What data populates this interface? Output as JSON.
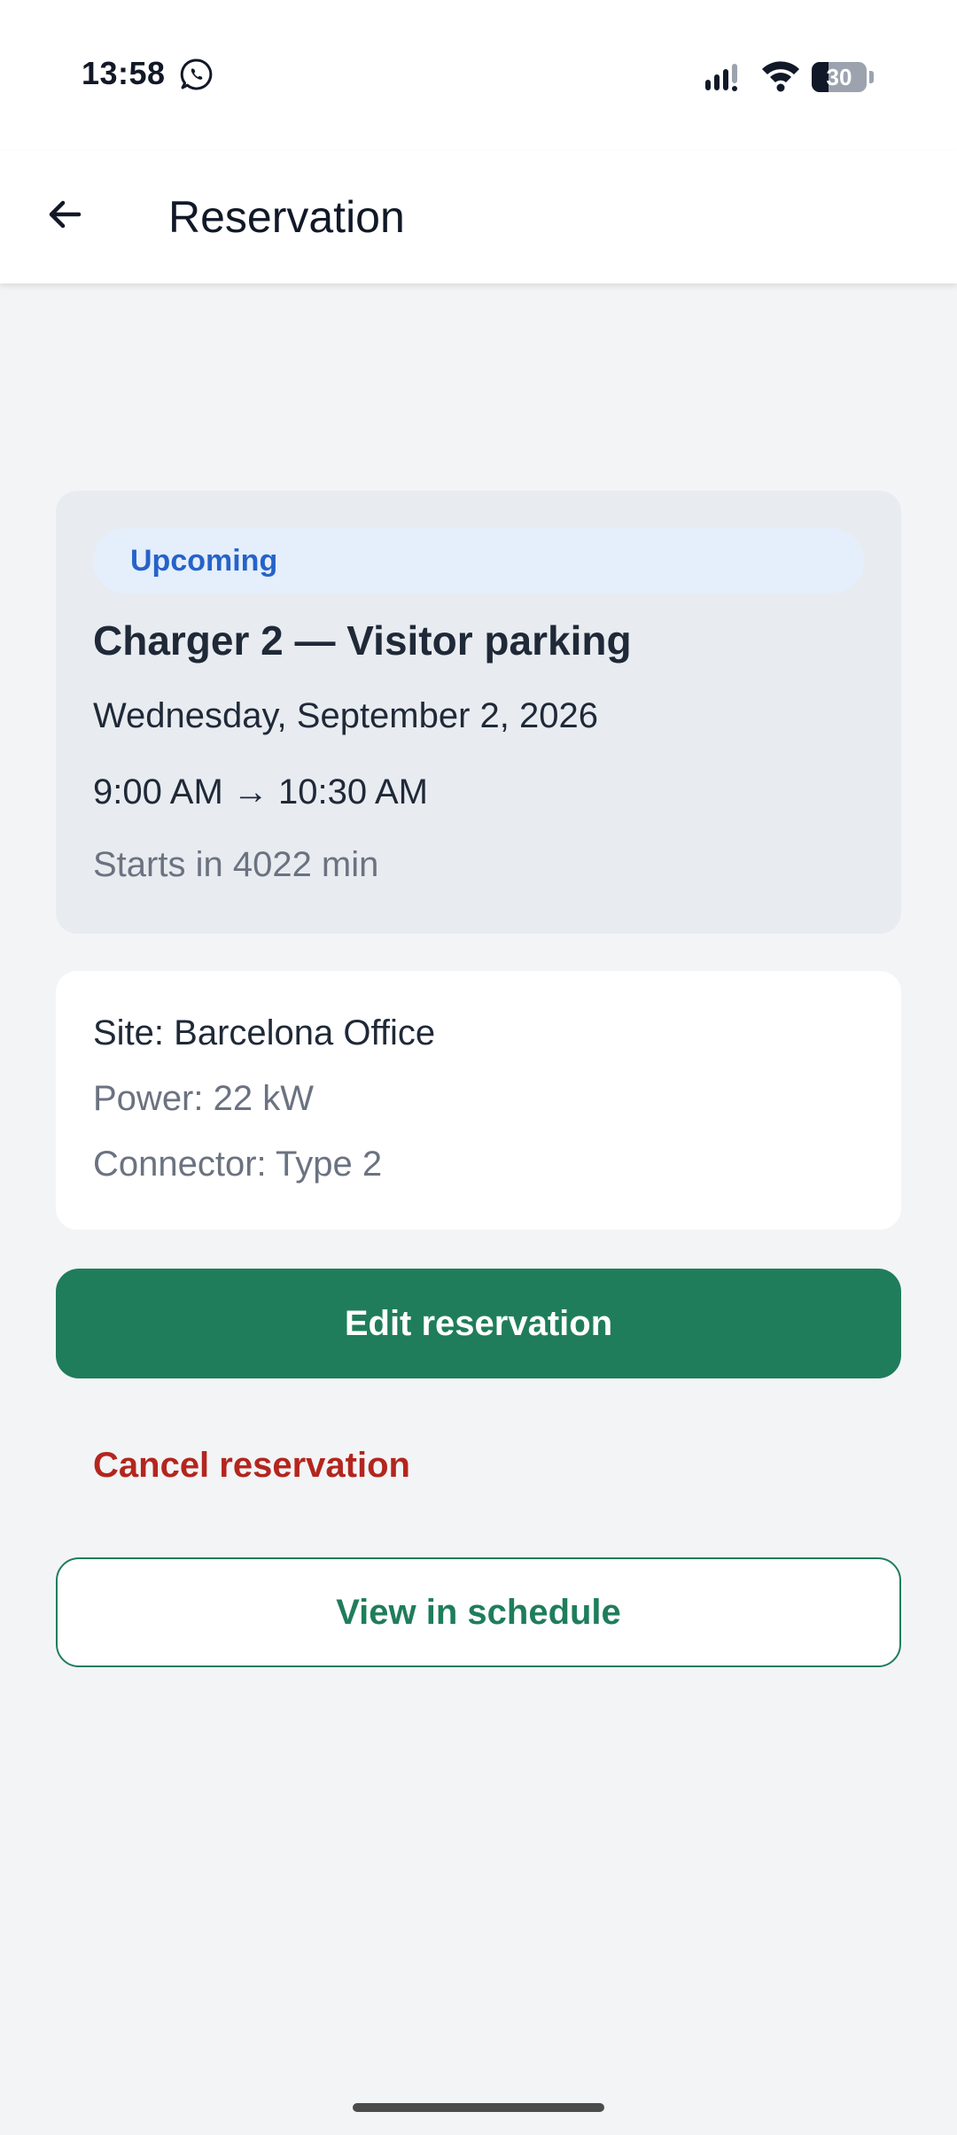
{
  "status_bar": {
    "time": "13:58",
    "battery_level": "30",
    "battery_fraction": 0.3
  },
  "app_bar": {
    "title": "Reservation"
  },
  "reservation": {
    "status": "Upcoming",
    "charger": "Charger 2 — Visitor parking",
    "date": "Wednesday, September 2, 2026",
    "time_range": "9:00 AM → 10:30 AM",
    "countdown": "Starts in 4022 min"
  },
  "details": {
    "site": "Site: Barcelona Office",
    "power": "Power: 22 kW",
    "connector": "Connector: Type 2"
  },
  "actions": {
    "edit_label": "Edit reservation",
    "cancel_label": "Cancel reservation",
    "schedule_label": "View in schedule"
  },
  "colors": {
    "primary": "#1f7d5b",
    "danger": "#b3261e",
    "status_badge_text": "#2563c9",
    "status_badge_bg": "#e5eefb",
    "background": "#f3f4f6"
  },
  "icons": {
    "back": "arrow-left-icon",
    "messaging": "whatsapp-icon",
    "signal": "signal-icon",
    "wifi": "wifi-icon",
    "battery": "battery-icon"
  }
}
